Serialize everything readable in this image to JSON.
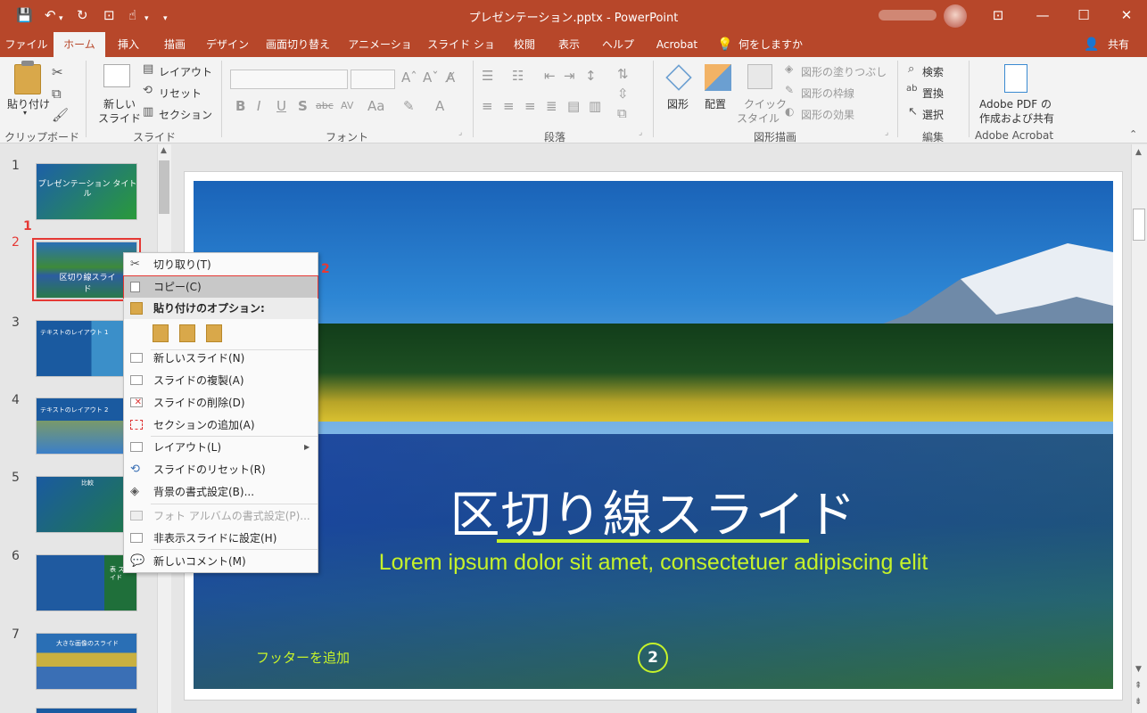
{
  "window": {
    "title": "プレゼンテーション.pptx - PowerPoint",
    "share_label": "共有",
    "min_glyph": "—",
    "max_glyph": "☐",
    "close_glyph": "✕",
    "restore_glyph": "⊡"
  },
  "tabs": [
    {
      "label": "ファイル"
    },
    {
      "label": "ホーム"
    },
    {
      "label": "挿入"
    },
    {
      "label": "描画"
    },
    {
      "label": "デザイン"
    },
    {
      "label": "画面切り替え"
    },
    {
      "label": "アニメーション"
    },
    {
      "label": "スライド ショー"
    },
    {
      "label": "校閲"
    },
    {
      "label": "表示"
    },
    {
      "label": "ヘルプ"
    },
    {
      "label": "Acrobat"
    },
    {
      "label": "何をしますか"
    }
  ],
  "ribbon": {
    "clipboard": {
      "paste": "貼り付け",
      "group": "クリップボード"
    },
    "slides": {
      "new_slide_1": "新しい",
      "new_slide_2": "スライド",
      "layout": "レイアウト",
      "reset": "リセット",
      "section": "セクション",
      "group": "スライド"
    },
    "font": {
      "group": "フォント",
      "bold": "B",
      "italic": "I",
      "underline": "U",
      "shadow": "S",
      "strike": "abc",
      "spacing": "AV",
      "case": "Aa",
      "color": "A"
    },
    "paragraph": {
      "group": "段落"
    },
    "drawing": {
      "shape": "図形",
      "arrange": "配置",
      "quick_1": "クイック",
      "quick_2": "スタイル",
      "fill": "図形の塗りつぶし",
      "outline": "図形の枠線",
      "effect": "図形の効果",
      "group": "図形描画"
    },
    "editing": {
      "find": "検索",
      "replace": "置換",
      "select": "選択",
      "group": "編集"
    },
    "acrobat": {
      "line1": "Adobe PDF の",
      "line2": "作成および共有",
      "group": "Adobe Acrobat"
    }
  },
  "thumbnails": [
    {
      "num": "1",
      "caption": "プレゼンテーション タイトル"
    },
    {
      "num": "2",
      "caption": "区切り線スライド"
    },
    {
      "num": "3",
      "caption": "テキストのレイアウト 1"
    },
    {
      "num": "4",
      "caption": "テキストのレイアウト 2"
    },
    {
      "num": "5",
      "caption": "比較"
    },
    {
      "num": "6",
      "caption": "表 スライド"
    },
    {
      "num": "7",
      "caption": "大きな画像のスライド"
    }
  ],
  "callouts": {
    "one": "1",
    "two": "2"
  },
  "context_menu": {
    "cut": "切り取り(T)",
    "copy": "コピー(C)",
    "paste_options": "貼り付けのオプション:",
    "new_slide": "新しいスライド(N)",
    "duplicate": "スライドの複製(A)",
    "delete": "スライドの削除(D)",
    "add_section": "セクションの追加(A)",
    "layout": "レイアウト(L)",
    "reset": "スライドのリセット(R)",
    "bg_format": "背景の書式設定(B)...",
    "photo_album": "フォト アルバムの書式設定(P)...",
    "hide": "非表示スライドに設定(H)",
    "new_comment": "新しいコメント(M)"
  },
  "slide": {
    "title": "区切り線スライド",
    "subtitle": "Lorem ipsum dolor sit amet, consectetuer adipiscing elit",
    "footer": "フッターを追加",
    "page": "2"
  },
  "colors": {
    "accent": "#b7472a",
    "slide_text_accent": "#c6f22a",
    "highlight_border": "#e53935"
  }
}
